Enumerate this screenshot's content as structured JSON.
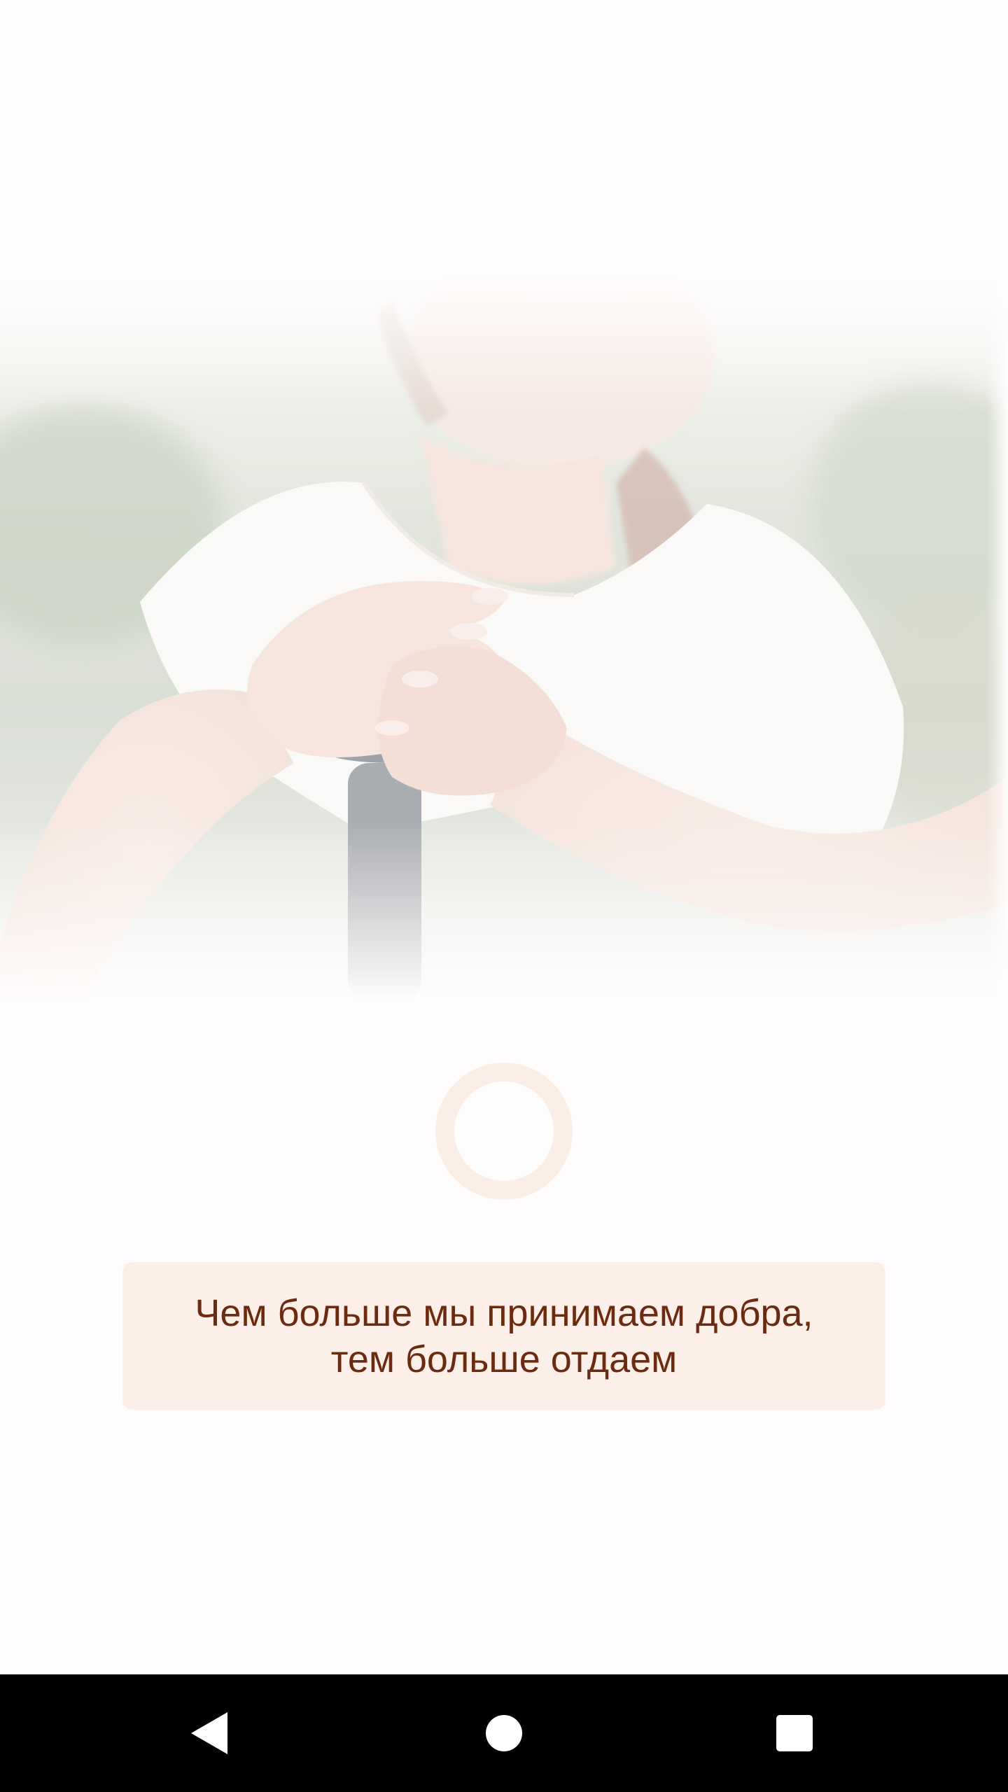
{
  "quote": {
    "text": "Чем больше мы принимаем добра,\nтем больше отдаем"
  },
  "hero_image": {
    "icon": "photo-hands-on-cane"
  },
  "loading": {
    "icon": "loading-ring-icon"
  },
  "navigation_bar": {
    "back_icon": "back-triangle-icon",
    "home_icon": "home-circle-icon",
    "recents_icon": "recents-square-icon"
  },
  "colors": {
    "background": "#fefcfc",
    "card_background": "#fcefe8",
    "quote_text": "#6b2b10",
    "spinner": "#fbeee7",
    "nav_bar": "#000000"
  }
}
